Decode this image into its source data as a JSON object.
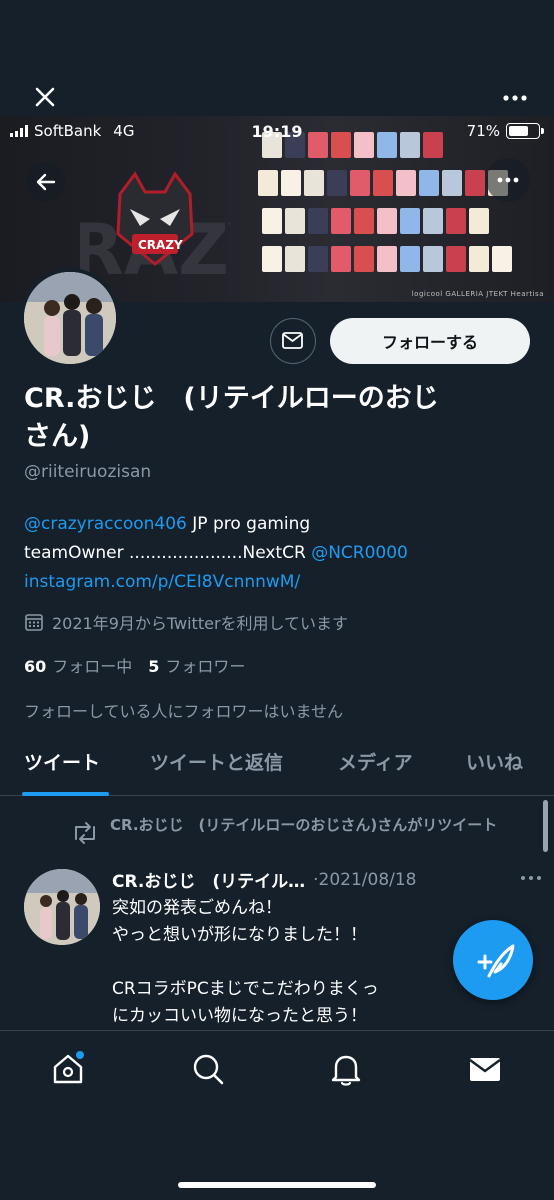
{
  "status_bar": {
    "carrier": "SoftBank",
    "network": "4G",
    "time": "19:19",
    "battery": "71%",
    "battery_level": 0.71
  },
  "banner": {
    "footer_text": "logicool  GALLERIA  JTEKT  Heartisa"
  },
  "profile": {
    "follow_label": "フォローする",
    "name_line1": "CR.おじじ　(リテイルローのおじ",
    "name_line2": "さん)",
    "handle": "@riiteiruozisan",
    "bio": {
      "mention1": "@crazyraccoon406",
      "text1": " JP pro gaming",
      "text2": "teamOwner .....................NextCR ",
      "mention2": "@NCR0000",
      "link": "instagram.com/p/CEI8VcnnnwM/"
    },
    "joined": "2021年9月からTwitterを利用しています",
    "following_count": "60",
    "following_label": "フォロー中",
    "followers_count": "5",
    "followers_label": "フォロワー",
    "mutual_note": "フォローしている人にフォロワーはいません"
  },
  "tabs": [
    "ツイート",
    "ツイートと返信",
    "メディア",
    "いいね"
  ],
  "tweet": {
    "retweet_line": "CR.おじじ　(リテイルローのおじさん)さんがリツイート",
    "name": "CR.おじじ　(リテイル…",
    "date": "·2021/08/18",
    "body": "突如の発表ごめんね！\nやっと想いが形になりました！！\n\nCRコラボPCまじでこだわりまくっ\nにカッコいい物になったと思う！"
  },
  "colors": {
    "background": "#15202b",
    "accent": "#1d9bf0",
    "muted": "#8b98a5"
  },
  "icons": [
    "close-icon",
    "more-icon",
    "back-arrow-icon",
    "mail-icon",
    "calendar-icon",
    "retweet-icon",
    "compose-icon",
    "home-icon",
    "search-icon",
    "bell-icon",
    "messages-icon"
  ]
}
